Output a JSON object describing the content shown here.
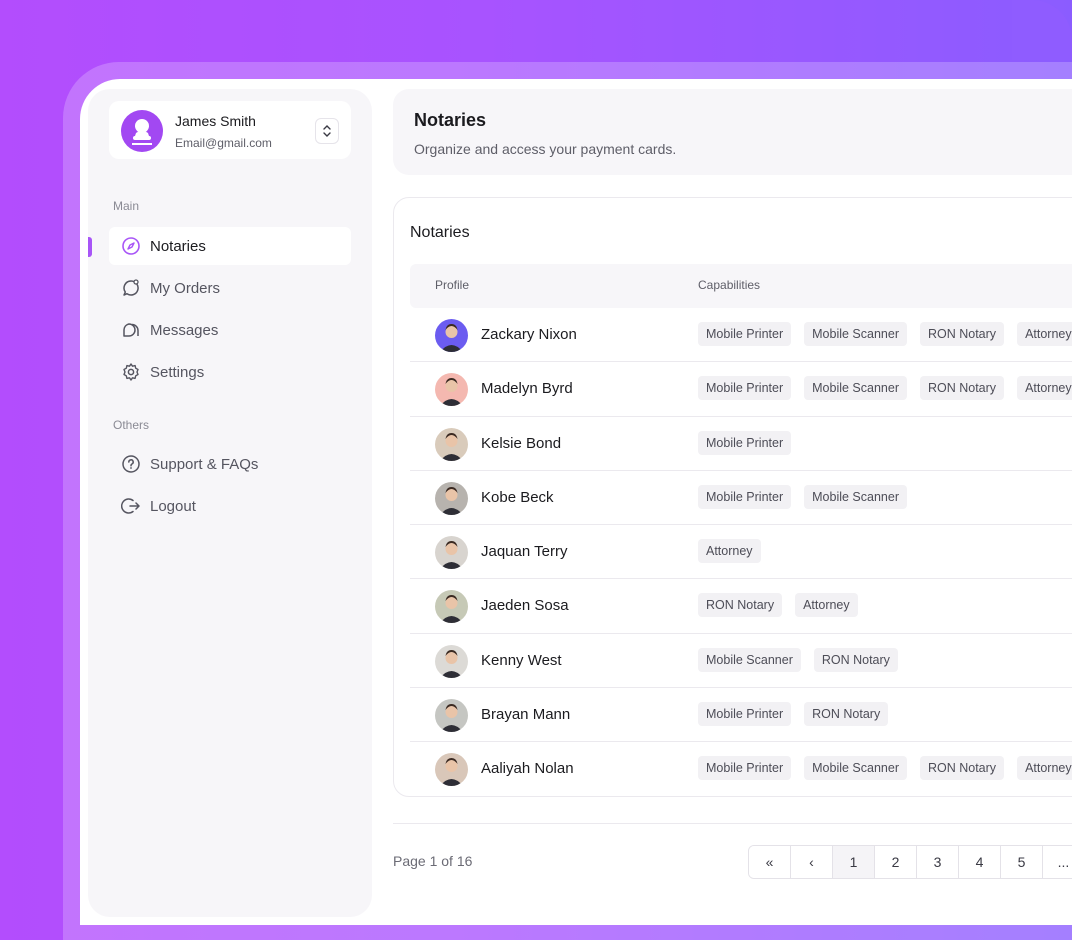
{
  "user": {
    "name": "James Smith",
    "email": "Email@gmail.com"
  },
  "sidebar": {
    "main_label": "Main",
    "others_label": "Others",
    "items": [
      {
        "label": "Notaries",
        "icon": "compass-icon",
        "active": true
      },
      {
        "label": "My Orders",
        "icon": "chat-bubble-icon",
        "active": false
      },
      {
        "label": "Messages",
        "icon": "messages-icon",
        "active": false
      },
      {
        "label": "Settings",
        "icon": "gear-icon",
        "active": false
      }
    ],
    "others": [
      {
        "label": "Support & FAQs",
        "icon": "question-circle-icon"
      },
      {
        "label": "Logout",
        "icon": "logout-icon"
      }
    ]
  },
  "header": {
    "title": "Notaries",
    "subtitle": "Organize and access your payment cards."
  },
  "table": {
    "title": "Notaries",
    "columns": [
      "Profile",
      "Capabilities"
    ],
    "rows": [
      {
        "name": "Zackary Nixon",
        "tags": [
          "Mobile Printer",
          "Mobile Scanner",
          "RON Notary",
          "Attorney"
        ],
        "avatar_color": "#6b5cf0"
      },
      {
        "name": "Madelyn Byrd",
        "tags": [
          "Mobile Printer",
          "Mobile Scanner",
          "RON Notary",
          "Attorney"
        ],
        "avatar_color": "#f4b8b0"
      },
      {
        "name": "Kelsie Bond",
        "tags": [
          "Mobile Printer"
        ],
        "avatar_color": "#d9cbbb"
      },
      {
        "name": "Kobe Beck",
        "tags": [
          "Mobile Printer",
          "Mobile Scanner"
        ],
        "avatar_color": "#b7b3ae"
      },
      {
        "name": "Jaquan Terry",
        "tags": [
          "Attorney"
        ],
        "avatar_color": "#d8d4cf"
      },
      {
        "name": "Jaeden Sosa",
        "tags": [
          "RON Notary",
          "Attorney"
        ],
        "avatar_color": "#c6c9b6"
      },
      {
        "name": "Kenny West",
        "tags": [
          "Mobile Scanner",
          "RON Notary"
        ],
        "avatar_color": "#dcdad6"
      },
      {
        "name": "Brayan Mann",
        "tags": [
          "Mobile Printer",
          "RON Notary"
        ],
        "avatar_color": "#c5c6c2"
      },
      {
        "name": "Aaliyah Nolan",
        "tags": [
          "Mobile Printer",
          "Mobile Scanner",
          "RON Notary",
          "Attorney"
        ],
        "avatar_color": "#d9c7b9"
      }
    ]
  },
  "pagination": {
    "info": "Page 1 of 16",
    "first": "«",
    "prev": "‹",
    "pages": [
      "1",
      "2",
      "3",
      "4",
      "5",
      "..."
    ],
    "current": "1"
  },
  "colors": {
    "accent": "#a855f7",
    "background_gradient_start": "#b34dfd",
    "background_gradient_end": "#8b5cff"
  }
}
